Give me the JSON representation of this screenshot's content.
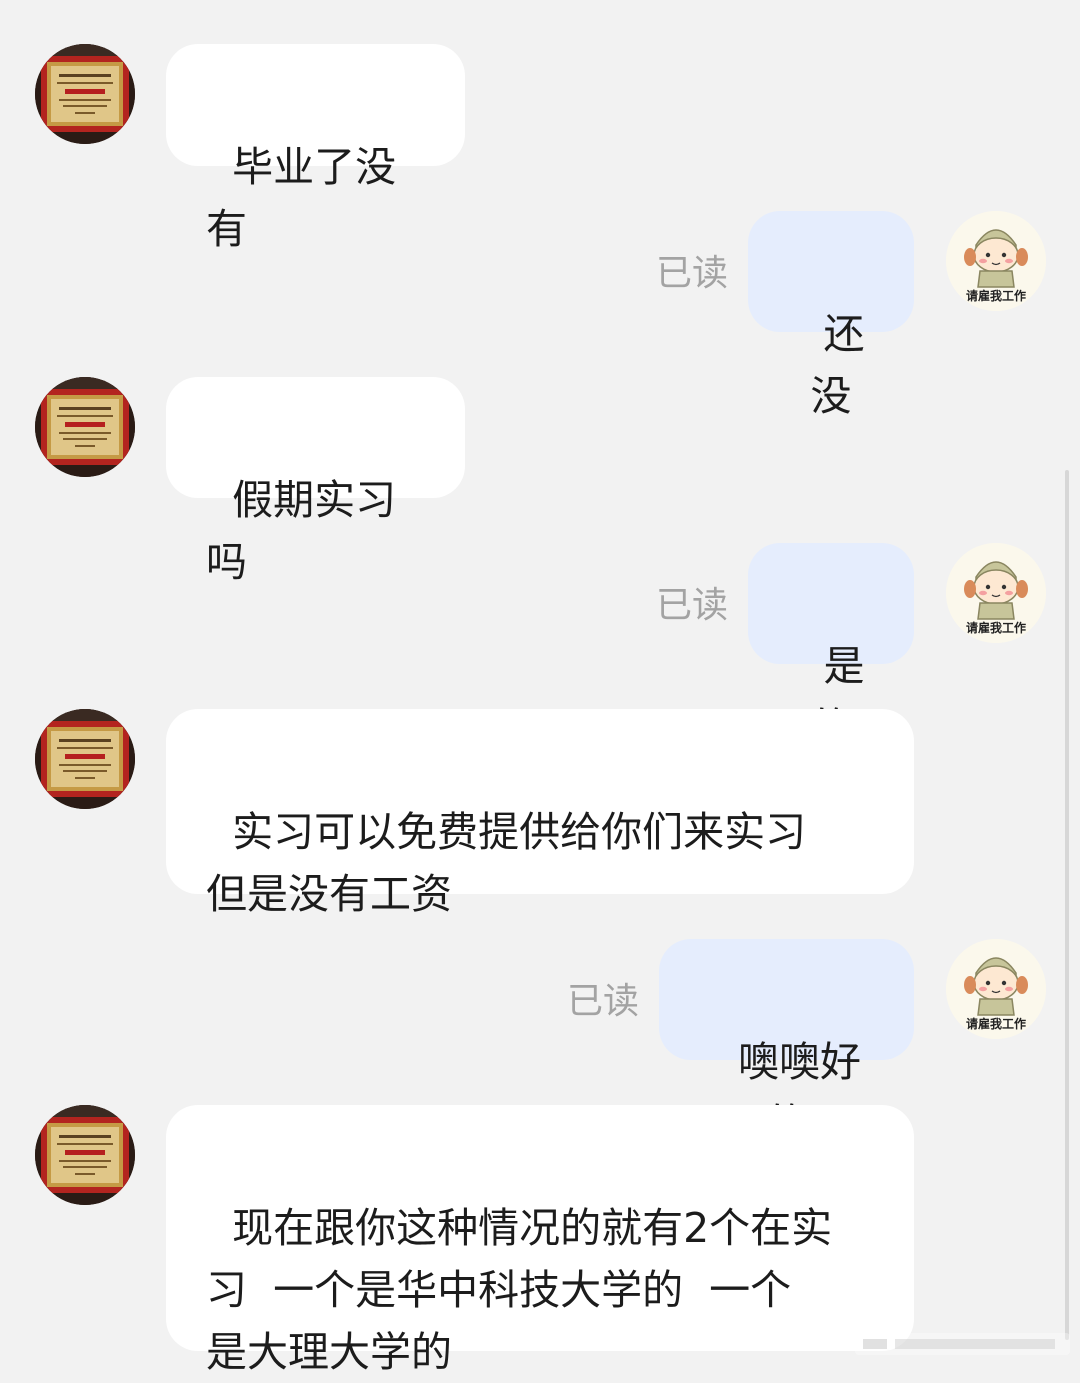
{
  "conversation": {
    "messages": [
      {
        "side": "left",
        "text": "毕业了没有"
      },
      {
        "side": "right",
        "text": "还没",
        "status": "已读"
      },
      {
        "side": "left",
        "text": "假期实习吗"
      },
      {
        "side": "right",
        "text": "是的",
        "status": "已读"
      },
      {
        "side": "left",
        "text": "实习可以免费提供给你们来实习\n但是没有工资"
      },
      {
        "side": "right",
        "text": "噢噢好的",
        "status": "已读"
      },
      {
        "side": "left",
        "text": "现在跟你这种情况的就有2个在实\n习  一个是华中科技大学的  一个\n是大理大学的"
      }
    ]
  },
  "me_avatar": {
    "caption": "请雇我工作"
  },
  "colors": {
    "background": "#f2f2f2",
    "bubble_left": "#ffffff",
    "bubble_right": "#e5edfd",
    "read_status": "#a3a3a3",
    "certificate_frame": "#b58a3a",
    "certificate_red": "#b51f1f"
  },
  "icons": {
    "contact_avatar": "certificate-plaque-icon",
    "my_avatar": "cartoon-girl-sticker-icon"
  }
}
